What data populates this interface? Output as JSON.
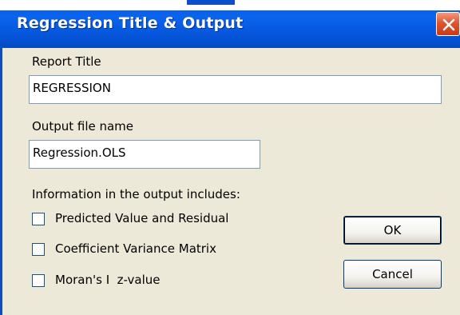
{
  "window": {
    "title": "Regression Title & Output"
  },
  "report_title": {
    "label": "Report Title",
    "value": "REGRESSION"
  },
  "output_file": {
    "label": "Output file name",
    "value": "Regression.OLS"
  },
  "output_includes": {
    "label": "Information in the output includes:",
    "options": [
      {
        "label": "Predicted Value and Residual",
        "checked": false
      },
      {
        "label": "Coefficient Variance Matrix",
        "checked": false
      },
      {
        "label": "Moran's I  z-value",
        "checked": false
      }
    ]
  },
  "buttons": {
    "ok": "OK",
    "cancel": "Cancel"
  },
  "colors": {
    "titlebar": "#0a5ae0",
    "close_button": "#e2542d",
    "dialog_face": "#ece9d8",
    "textbox_border": "#7f9db9",
    "checkbox_border": "#1c5180",
    "button_border": "#003c74"
  },
  "icons": {
    "close": "close-icon"
  }
}
